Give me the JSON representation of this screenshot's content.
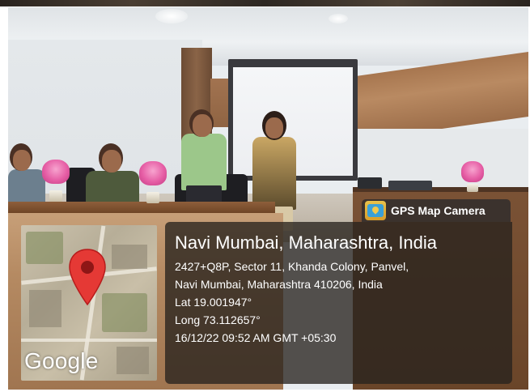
{
  "badge": {
    "label": "GPS Map Camera",
    "icon": "gps-map-camera-icon"
  },
  "location": {
    "title": "Navi Mumbai, Maharashtra, India",
    "address_line1": "2427+Q8P, Sector 11, Khanda Colony, Panvel,",
    "address_line2": "Navi Mumbai, Maharashtra 410206, India",
    "latitude": "Lat 19.001947°",
    "longitude": "Long 73.112657°",
    "datetime": "16/12/22 09:52 AM GMT +05:30"
  },
  "map": {
    "attribution": "Google",
    "pin_icon": "map-pin-icon",
    "pin_color": "#e53935"
  },
  "colors": {
    "panel_background": "#28221e",
    "text": "#ffffff",
    "flowers": "#e65ea5"
  }
}
